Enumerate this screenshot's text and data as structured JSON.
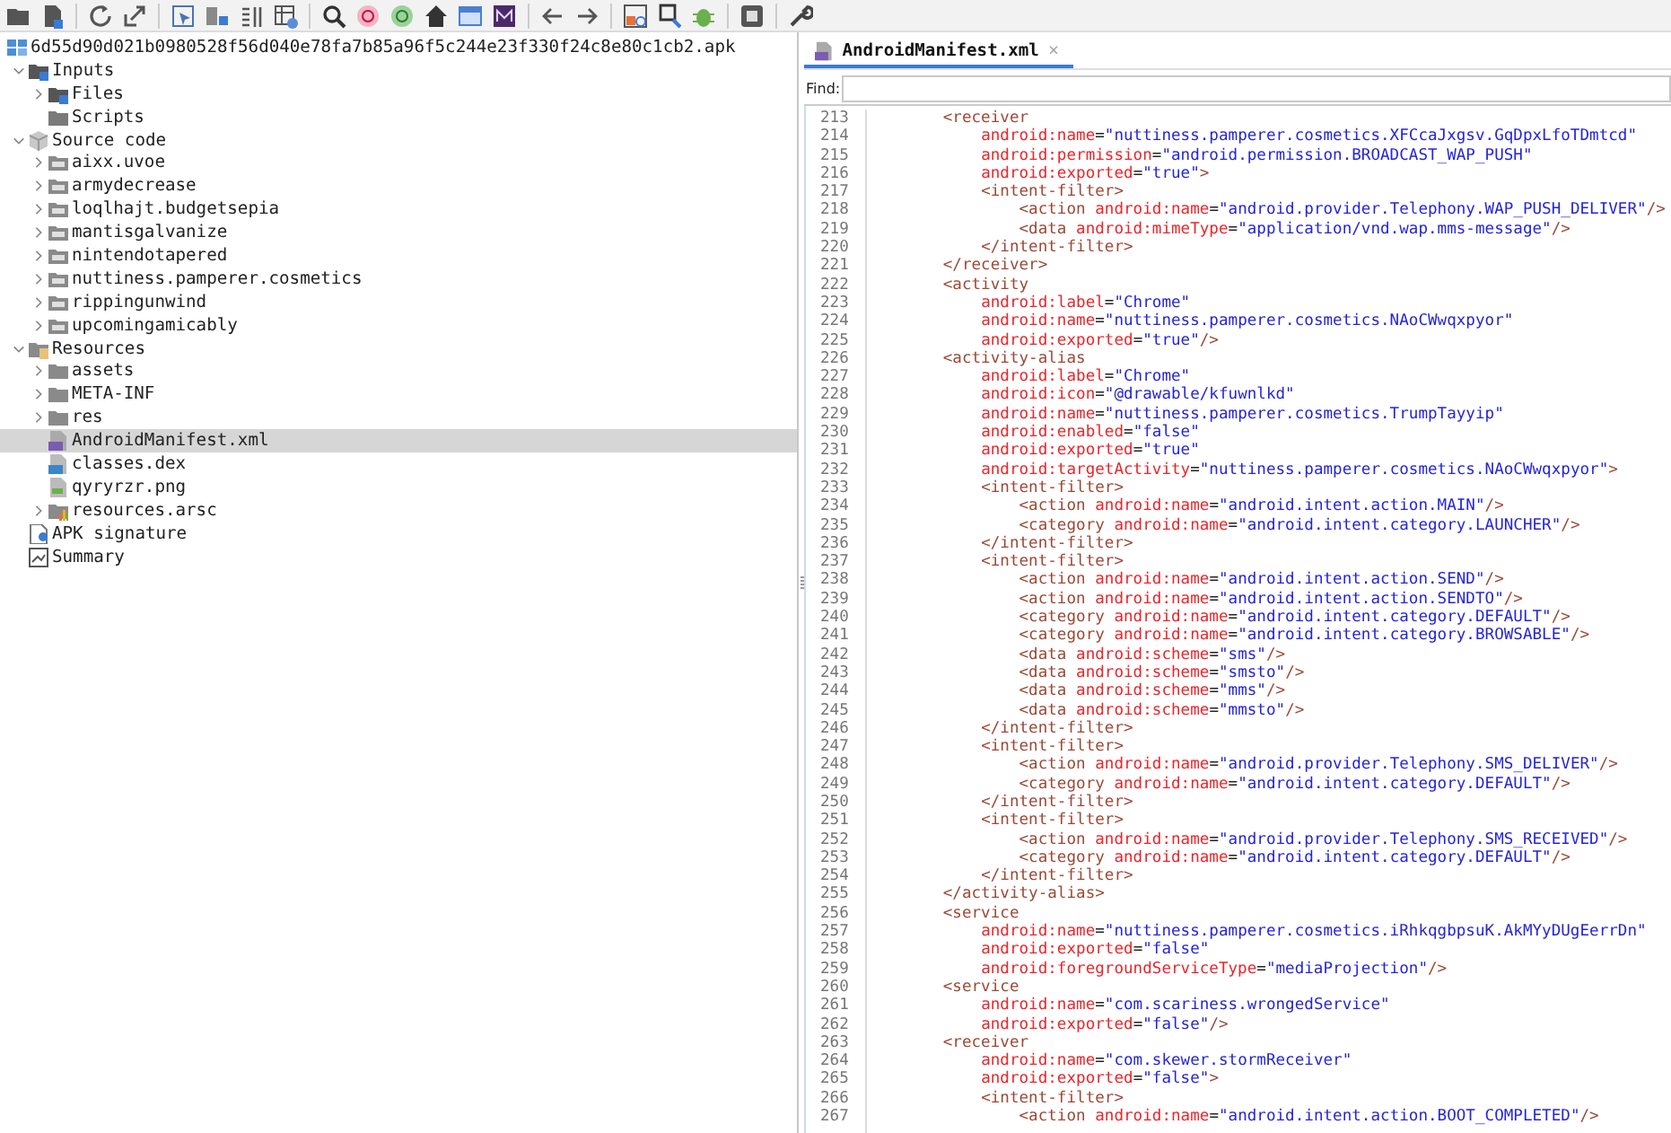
{
  "tree": {
    "label": "6d55d90d021b0980528f56d040e78fa7b85a96f5c244e23f330f24c8e80c1cb2.apk",
    "kind": "project",
    "children": [
      {
        "label": "Inputs",
        "kind": "inputs",
        "expanded": true,
        "selected": false,
        "children": [
          {
            "label": "Files",
            "kind": "inputs",
            "expanded": false,
            "selected": false
          },
          {
            "label": "Scripts",
            "kind": "folder-dark",
            "selected": false
          }
        ]
      },
      {
        "label": "Source code",
        "kind": "package",
        "expanded": true,
        "selected": false,
        "children": [
          {
            "label": "aixx.uvoe",
            "kind": "package-folder",
            "expanded": false,
            "selected": false
          },
          {
            "label": "armydecrease",
            "kind": "package-folder",
            "expanded": false,
            "selected": false
          },
          {
            "label": "loqlhajt.budgetsepia",
            "kind": "package-folder",
            "expanded": false,
            "selected": false
          },
          {
            "label": "mantisgalvanize",
            "kind": "package-folder",
            "expanded": false,
            "selected": false
          },
          {
            "label": "nintendotapered",
            "kind": "package-folder",
            "expanded": false,
            "selected": false
          },
          {
            "label": "nuttiness.pamperer.cosmetics",
            "kind": "package-folder",
            "expanded": false,
            "selected": false
          },
          {
            "label": "rippingunwind",
            "kind": "package-folder",
            "expanded": false,
            "selected": false
          },
          {
            "label": "upcomingamicably",
            "kind": "package-folder",
            "expanded": false,
            "selected": false
          }
        ]
      },
      {
        "label": "Resources",
        "kind": "resources",
        "expanded": true,
        "selected": false,
        "children": [
          {
            "label": "assets",
            "kind": "folder",
            "expanded": false,
            "selected": false
          },
          {
            "label": "META-INF",
            "kind": "folder",
            "expanded": false,
            "selected": false
          },
          {
            "label": "res",
            "kind": "folder",
            "expanded": false,
            "selected": false
          },
          {
            "label": "AndroidManifest.xml",
            "kind": "manifest",
            "selected": true
          },
          {
            "label": "classes.dex",
            "kind": "dex",
            "selected": false
          },
          {
            "label": "qyryrzr.png",
            "kind": "image",
            "selected": false
          },
          {
            "label": "resources.arsc",
            "kind": "arsc",
            "expanded": false,
            "selected": false
          }
        ]
      },
      {
        "label": "APK signature",
        "kind": "signature",
        "selected": false
      },
      {
        "label": "Summary",
        "kind": "summary",
        "selected": false
      }
    ]
  },
  "tabs": [
    {
      "label": "AndroidManifest.xml",
      "close": "×",
      "selected": true
    }
  ],
  "find": {
    "label": "Find:"
  },
  "code": [
    {
      "n": "213",
      "text": "        <receiver"
    },
    {
      "n": "214",
      "text": "            android:name=\"nuttiness.pamperer.cosmetics.XFCcaJxgsv.GqDpxLfoTDmtcd\""
    },
    {
      "n": "215",
      "text": "            android:permission=\"android.permission.BROADCAST_WAP_PUSH\""
    },
    {
      "n": "216",
      "text": "            android:exported=\"true\">"
    },
    {
      "n": "217",
      "text": "            <intent-filter>"
    },
    {
      "n": "218",
      "text": "                <action android:name=\"android.provider.Telephony.WAP_PUSH_DELIVER\"/>"
    },
    {
      "n": "219",
      "text": "                <data android:mimeType=\"application/vnd.wap.mms-message\"/>"
    },
    {
      "n": "220",
      "text": "            </intent-filter>"
    },
    {
      "n": "221",
      "text": "        </receiver>"
    },
    {
      "n": "222",
      "text": "        <activity"
    },
    {
      "n": "223",
      "text": "            android:label=\"Chrome\""
    },
    {
      "n": "224",
      "text": "            android:name=\"nuttiness.pamperer.cosmetics.NAoCWwqxpyor\""
    },
    {
      "n": "225",
      "text": "            android:exported=\"true\"/>"
    },
    {
      "n": "226",
      "text": "        <activity-alias"
    },
    {
      "n": "227",
      "text": "            android:label=\"Chrome\""
    },
    {
      "n": "228",
      "text": "            android:icon=\"@drawable/kfuwnlkd\""
    },
    {
      "n": "229",
      "text": "            android:name=\"nuttiness.pamperer.cosmetics.TrumpTayyip\""
    },
    {
      "n": "230",
      "text": "            android:enabled=\"false\""
    },
    {
      "n": "231",
      "text": "            android:exported=\"true\""
    },
    {
      "n": "232",
      "text": "            android:targetActivity=\"nuttiness.pamperer.cosmetics.NAoCWwqxpyor\">"
    },
    {
      "n": "233",
      "text": "            <intent-filter>"
    },
    {
      "n": "234",
      "text": "                <action android:name=\"android.intent.action.MAIN\"/>"
    },
    {
      "n": "235",
      "text": "                <category android:name=\"android.intent.category.LAUNCHER\"/>"
    },
    {
      "n": "236",
      "text": "            </intent-filter>"
    },
    {
      "n": "237",
      "text": "            <intent-filter>"
    },
    {
      "n": "238",
      "text": "                <action android:name=\"android.intent.action.SEND\"/>"
    },
    {
      "n": "239",
      "text": "                <action android:name=\"android.intent.action.SENDTO\"/>"
    },
    {
      "n": "240",
      "text": "                <category android:name=\"android.intent.category.DEFAULT\"/>"
    },
    {
      "n": "241",
      "text": "                <category android:name=\"android.intent.category.BROWSABLE\"/>"
    },
    {
      "n": "242",
      "text": "                <data android:scheme=\"sms\"/>"
    },
    {
      "n": "243",
      "text": "                <data android:scheme=\"smsto\"/>"
    },
    {
      "n": "244",
      "text": "                <data android:scheme=\"mms\"/>"
    },
    {
      "n": "245",
      "text": "                <data android:scheme=\"mmsto\"/>"
    },
    {
      "n": "246",
      "text": "            </intent-filter>"
    },
    {
      "n": "247",
      "text": "            <intent-filter>"
    },
    {
      "n": "248",
      "text": "                <action android:name=\"android.provider.Telephony.SMS_DELIVER\"/>"
    },
    {
      "n": "249",
      "text": "                <category android:name=\"android.intent.category.DEFAULT\"/>"
    },
    {
      "n": "250",
      "text": "            </intent-filter>"
    },
    {
      "n": "251",
      "text": "            <intent-filter>"
    },
    {
      "n": "252",
      "text": "                <action android:name=\"android.provider.Telephony.SMS_RECEIVED\"/>"
    },
    {
      "n": "253",
      "text": "                <category android:name=\"android.intent.category.DEFAULT\"/>"
    },
    {
      "n": "254",
      "text": "            </intent-filter>"
    },
    {
      "n": "255",
      "text": "        </activity-alias>"
    },
    {
      "n": "256",
      "text": "        <service"
    },
    {
      "n": "257",
      "text": "            android:name=\"nuttiness.pamperer.cosmetics.iRhkqgbpsuK.AkMYyDUgEerrDn\""
    },
    {
      "n": "258",
      "text": "            android:exported=\"false\""
    },
    {
      "n": "259",
      "text": "            android:foregroundServiceType=\"mediaProjection\"/>"
    },
    {
      "n": "260",
      "text": "        <service"
    },
    {
      "n": "261",
      "text": "            android:name=\"com.scariness.wrongedService\""
    },
    {
      "n": "262",
      "text": "            android:exported=\"false\"/>"
    },
    {
      "n": "263",
      "text": "        <receiver"
    },
    {
      "n": "264",
      "text": "            android:name=\"com.skewer.stormReceiver\""
    },
    {
      "n": "265",
      "text": "            android:exported=\"false\">"
    },
    {
      "n": "266",
      "text": "            <intent-filter>"
    },
    {
      "n": "267",
      "text": "                <action android:name=\"android.intent.action.BOOT_COMPLETED\"/>"
    }
  ]
}
